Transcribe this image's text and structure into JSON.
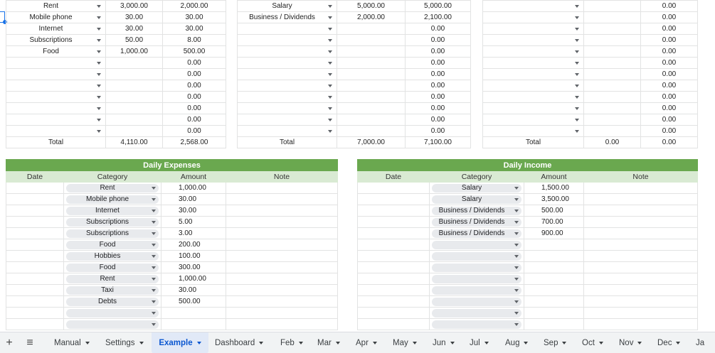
{
  "expenses_summary": {
    "rows": [
      {
        "category": "Rent",
        "budget": "3,000.00",
        "actual": "2,000.00"
      },
      {
        "category": "Mobile phone",
        "budget": "30.00",
        "actual": "30.00"
      },
      {
        "category": "Internet",
        "budget": "30.00",
        "actual": "30.00"
      },
      {
        "category": "Subscriptions",
        "budget": "50.00",
        "actual": "8.00"
      },
      {
        "category": "Food",
        "budget": "1,000.00",
        "actual": "500.00"
      },
      {
        "category": "",
        "budget": "",
        "actual": "0.00"
      },
      {
        "category": "",
        "budget": "",
        "actual": "0.00"
      },
      {
        "category": "",
        "budget": "",
        "actual": "0.00"
      },
      {
        "category": "",
        "budget": "",
        "actual": "0.00"
      },
      {
        "category": "",
        "budget": "",
        "actual": "0.00"
      },
      {
        "category": "",
        "budget": "",
        "actual": "0.00"
      },
      {
        "category": "",
        "budget": "",
        "actual": "0.00"
      }
    ],
    "total_label": "Total",
    "total_budget": "4,110.00",
    "total_actual": "2,568.00"
  },
  "income_summary": {
    "rows": [
      {
        "category": "Salary",
        "budget": "5,000.00",
        "actual": "5,000.00"
      },
      {
        "category": "Business / Dividends",
        "budget": "2,000.00",
        "actual": "2,100.00"
      },
      {
        "category": "",
        "budget": "",
        "actual": "0.00"
      },
      {
        "category": "",
        "budget": "",
        "actual": "0.00"
      },
      {
        "category": "",
        "budget": "",
        "actual": "0.00"
      },
      {
        "category": "",
        "budget": "",
        "actual": "0.00"
      },
      {
        "category": "",
        "budget": "",
        "actual": "0.00"
      },
      {
        "category": "",
        "budget": "",
        "actual": "0.00"
      },
      {
        "category": "",
        "budget": "",
        "actual": "0.00"
      },
      {
        "category": "",
        "budget": "",
        "actual": "0.00"
      },
      {
        "category": "",
        "budget": "",
        "actual": "0.00"
      },
      {
        "category": "",
        "budget": "",
        "actual": "0.00"
      }
    ],
    "total_label": "Total",
    "total_budget": "7,000.00",
    "total_actual": "7,100.00"
  },
  "savings_summary": {
    "rows": [
      {
        "category": "",
        "budget": "",
        "actual": "0.00"
      },
      {
        "category": "",
        "budget": "",
        "actual": "0.00"
      },
      {
        "category": "",
        "budget": "",
        "actual": "0.00"
      },
      {
        "category": "",
        "budget": "",
        "actual": "0.00"
      },
      {
        "category": "",
        "budget": "",
        "actual": "0.00"
      },
      {
        "category": "",
        "budget": "",
        "actual": "0.00"
      },
      {
        "category": "",
        "budget": "",
        "actual": "0.00"
      },
      {
        "category": "",
        "budget": "",
        "actual": "0.00"
      },
      {
        "category": "",
        "budget": "",
        "actual": "0.00"
      },
      {
        "category": "",
        "budget": "",
        "actual": "0.00"
      },
      {
        "category": "",
        "budget": "",
        "actual": "0.00"
      },
      {
        "category": "",
        "budget": "",
        "actual": "0.00"
      }
    ],
    "total_label": "Total",
    "total_budget": "0.00",
    "total_actual": "0.00"
  },
  "daily_expenses": {
    "title": "Daily Expenses",
    "headers": {
      "date": "Date",
      "category": "Category",
      "amount": "Amount",
      "note": "Note"
    },
    "rows": [
      {
        "date": "",
        "category": "Rent",
        "amount": "1,000.00",
        "note": ""
      },
      {
        "date": "",
        "category": "Mobile phone",
        "amount": "30.00",
        "note": ""
      },
      {
        "date": "",
        "category": "Internet",
        "amount": "30.00",
        "note": ""
      },
      {
        "date": "",
        "category": "Subscriptions",
        "amount": "5.00",
        "note": ""
      },
      {
        "date": "",
        "category": "Subscriptions",
        "amount": "3.00",
        "note": ""
      },
      {
        "date": "",
        "category": "Food",
        "amount": "200.00",
        "note": ""
      },
      {
        "date": "",
        "category": "Hobbies",
        "amount": "100.00",
        "note": ""
      },
      {
        "date": "",
        "category": "Food",
        "amount": "300.00",
        "note": ""
      },
      {
        "date": "",
        "category": "Rent",
        "amount": "1,000.00",
        "note": ""
      },
      {
        "date": "",
        "category": "Taxi",
        "amount": "30.00",
        "note": ""
      },
      {
        "date": "",
        "category": "Debts",
        "amount": "500.00",
        "note": ""
      },
      {
        "date": "",
        "category": "",
        "amount": "",
        "note": ""
      },
      {
        "date": "",
        "category": "",
        "amount": "",
        "note": ""
      }
    ]
  },
  "daily_income": {
    "title": "Daily Income",
    "headers": {
      "date": "Date",
      "category": "Category",
      "amount": "Amount",
      "note": "Note"
    },
    "rows": [
      {
        "date": "",
        "category": "Salary",
        "amount": "1,500.00",
        "note": ""
      },
      {
        "date": "",
        "category": "Salary",
        "amount": "3,500.00",
        "note": ""
      },
      {
        "date": "",
        "category": "Business / Dividends",
        "amount": "500.00",
        "note": ""
      },
      {
        "date": "",
        "category": "Business / Dividends",
        "amount": "700.00",
        "note": ""
      },
      {
        "date": "",
        "category": "Business / Dividends",
        "amount": "900.00",
        "note": ""
      },
      {
        "date": "",
        "category": "",
        "amount": "",
        "note": ""
      },
      {
        "date": "",
        "category": "",
        "amount": "",
        "note": ""
      },
      {
        "date": "",
        "category": "",
        "amount": "",
        "note": ""
      },
      {
        "date": "",
        "category": "",
        "amount": "",
        "note": ""
      },
      {
        "date": "",
        "category": "",
        "amount": "",
        "note": ""
      },
      {
        "date": "",
        "category": "",
        "amount": "",
        "note": ""
      },
      {
        "date": "",
        "category": "",
        "amount": "",
        "note": ""
      },
      {
        "date": "",
        "category": "",
        "amount": "",
        "note": ""
      }
    ]
  },
  "tabbar": {
    "add_icon": "+",
    "menu_icon": "≡",
    "tabs": [
      {
        "label": "Manual",
        "active": false
      },
      {
        "label": "Settings",
        "active": false
      },
      {
        "label": "Example",
        "active": true
      },
      {
        "label": "Dashboard",
        "active": false
      },
      {
        "label": "Feb",
        "active": false
      },
      {
        "label": "Mar",
        "active": false
      },
      {
        "label": "Apr",
        "active": false
      },
      {
        "label": "May",
        "active": false
      },
      {
        "label": "Jun",
        "active": false
      },
      {
        "label": "Jul",
        "active": false
      },
      {
        "label": "Aug",
        "active": false
      },
      {
        "label": "Sep",
        "active": false
      },
      {
        "label": "Oct",
        "active": false
      },
      {
        "label": "Nov",
        "active": false
      },
      {
        "label": "Dec",
        "active": false
      },
      {
        "label": "Ja",
        "active": false
      }
    ]
  },
  "colors": {
    "header_green": "#6aa84f",
    "subheader_green": "#d9ead3",
    "active_tab": "#0b57d0"
  }
}
